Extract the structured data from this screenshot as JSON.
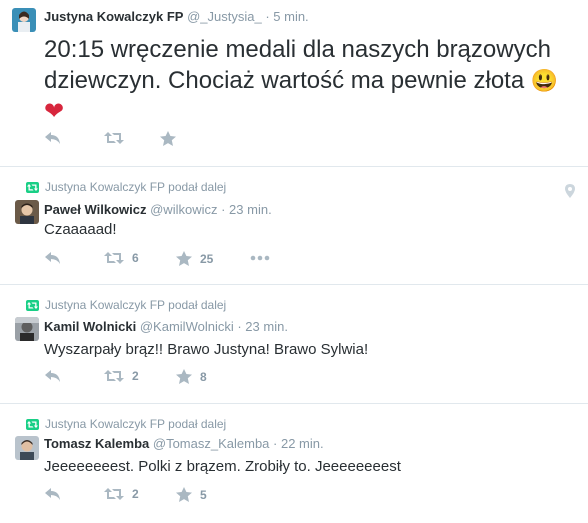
{
  "tweets": [
    {
      "retweeted_by": "",
      "name": "Justyna Kowalczyk FP",
      "handle": "@_Justysia_",
      "time": "· 5 min.",
      "text": "20:15 wręczenie medali dla naszych brązowych dziewczyn. Chociaż wartość ma pewnie złota",
      "emoji": [
        "😃",
        "❤"
      ],
      "retweets": "",
      "favorites": ""
    },
    {
      "retweeted_by": "Justyna Kowalczyk FP podał dalej",
      "name": "Paweł Wilkowicz",
      "handle": "@wilkowicz",
      "time": "· 23 min.",
      "text": "Czaaaaad!",
      "retweets": "6",
      "favorites": "25"
    },
    {
      "retweeted_by": "Justyna Kowalczyk FP podał dalej",
      "name": "Kamil Wolnicki",
      "handle": "@KamilWolnicki",
      "time": "· 23 min.",
      "text": "Wyszarpały brąz!! Brawo Justyna! Brawo Sylwia!",
      "retweets": "2",
      "favorites": "8"
    },
    {
      "retweeted_by": "Justyna Kowalczyk FP podał dalej",
      "name": "Tomasz Kalemba",
      "handle": "@Tomasz_Kalemba",
      "time": "· 22 min.",
      "text": "Jeeeeeeeest. Polki z brązem. Zrobiły to. Jeeeeeeeest",
      "retweets": "2",
      "favorites": "5"
    }
  ],
  "icons": {
    "reply": "reply-icon",
    "retweet": "retweet-icon",
    "favorite": "star-icon",
    "more": "more-icon",
    "geo": "location-pin-icon"
  },
  "colors": {
    "text": "#292f33",
    "muted": "#8899a6",
    "icon": "#aab8c2",
    "retweet_green": "#19cf86",
    "separator": "#e1e8ed"
  }
}
